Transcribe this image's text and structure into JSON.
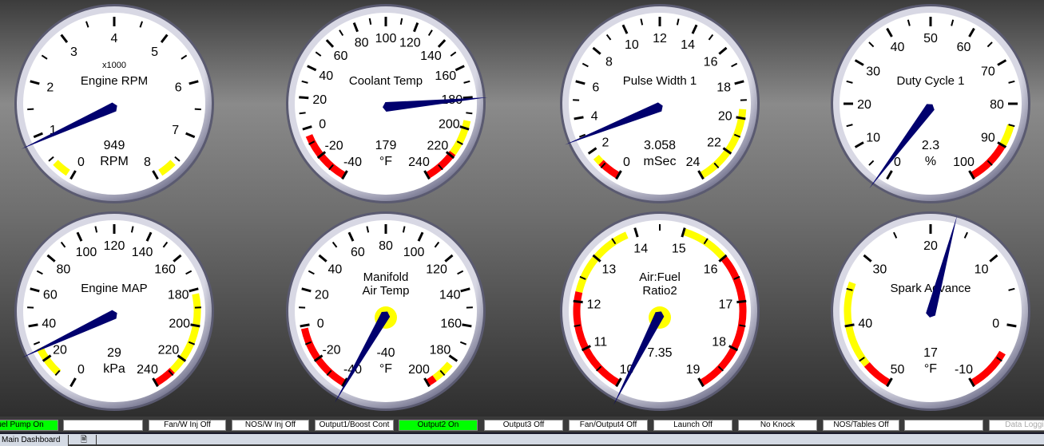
{
  "gauges": [
    {
      "title": "Engine RPM",
      "multiplier": "x1000",
      "value": "949",
      "units": "RPM",
      "needle": 0.949,
      "min": 0,
      "max": 8,
      "labels": [
        "0",
        "1",
        "2",
        "3",
        "4",
        "5",
        "6",
        "7",
        "8"
      ],
      "zones": [
        {
          "from": 0.1,
          "to": 0.4,
          "color": "#ffff00"
        },
        {
          "from": 7.6,
          "to": 7.9,
          "color": "#ffff00"
        }
      ],
      "hub": false
    },
    {
      "title": "Coolant Temp",
      "value": "179",
      "units": "°F",
      "needle": 179,
      "min": -40,
      "max": 240,
      "labels": [
        "-40",
        "-20",
        "0",
        "20",
        "40",
        "60",
        "80",
        "100",
        "120",
        "140",
        "160",
        "180",
        "200",
        "220",
        "240"
      ],
      "zones": [
        {
          "from": -40,
          "to": -5,
          "color": "#ff0000"
        },
        {
          "from": 195,
          "to": 220,
          "color": "#ffff00"
        },
        {
          "from": 218,
          "to": 240,
          "color": "#ff0000"
        }
      ],
      "hub": false
    },
    {
      "title": "Pulse Width 1",
      "value": "3.058",
      "units": "mSec",
      "needle": 3.058,
      "min": 0,
      "max": 24,
      "labels": [
        "0",
        "2",
        "4",
        "6",
        "8",
        "10",
        "12",
        "14",
        "16",
        "18",
        "20",
        "22",
        "24"
      ],
      "zones": [
        {
          "from": 0,
          "to": 1.2,
          "color": "#ff0000"
        },
        {
          "from": 1.2,
          "to": 1.6,
          "color": "#ffff00"
        },
        {
          "from": 19.5,
          "to": 24,
          "color": "#ffff00"
        },
        {
          "from": 24,
          "to": 25,
          "color": "#ff0000"
        }
      ],
      "hub": false
    },
    {
      "title": "Duty Cycle 1",
      "value": "2.3",
      "units": "%",
      "needle": 2.3,
      "min": 0,
      "max": 100,
      "labels": [
        "0",
        "10",
        "20",
        "30",
        "40",
        "50",
        "60",
        "70",
        "80",
        "90",
        "100"
      ],
      "zones": [
        {
          "from": 85,
          "to": 90,
          "color": "#ffff00"
        },
        {
          "from": 90,
          "to": 100,
          "color": "#ff0000"
        }
      ],
      "hub": false
    },
    {
      "title": "Engine MAP",
      "value": "29",
      "units": "kPa",
      "needle": 29,
      "min": 0,
      "max": 250,
      "labels": [
        "0",
        "20",
        "40",
        "60",
        "80",
        "100",
        "120",
        "140",
        "160",
        "180",
        "200",
        "220",
        "240"
      ],
      "zones": [
        {
          "from": 10,
          "to": 28,
          "color": "#ffff00"
        },
        {
          "from": 190,
          "to": 238,
          "color": "#ffff00"
        },
        {
          "from": 238,
          "to": 250,
          "color": "#ff0000"
        }
      ],
      "hub": false
    },
    {
      "title": "Manifold\nAir Temp",
      "value": "-40",
      "units": "°F",
      "needle": -40,
      "min": -40,
      "max": 210,
      "labels": [
        "-40",
        "-20",
        "0",
        "20",
        "40",
        "60",
        "80",
        "100",
        "120",
        "140",
        "160",
        "180",
        "200"
      ],
      "zones": [
        {
          "from": -40,
          "to": 0,
          "color": "#ff0000"
        },
        {
          "from": 193,
          "to": 205,
          "color": "#ffff00"
        },
        {
          "from": 205,
          "to": 210,
          "color": "#ff0000"
        }
      ],
      "hub": true
    },
    {
      "title": "Air:Fuel\nRatio2",
      "value": "7.35",
      "units": "",
      "needle": 7.35,
      "min": 10,
      "max": 19,
      "labels": [
        "10",
        "11",
        "12",
        "13",
        "14",
        "15",
        "16",
        "17",
        "18",
        "19"
      ],
      "zones": [
        {
          "from": 10,
          "to": 12.2,
          "color": "#ff0000"
        },
        {
          "from": 12.2,
          "to": 13.8,
          "color": "#ffff00"
        },
        {
          "from": 15,
          "to": 16,
          "color": "#ffff00"
        },
        {
          "from": 16,
          "to": 19,
          "color": "#ff0000"
        }
      ],
      "hub": true
    },
    {
      "title": "Spark Advance",
      "value": "17",
      "units": "°F",
      "needle": 17,
      "min": 50,
      "max": -10,
      "labels": [
        "50",
        "40",
        "30",
        "20",
        "10",
        "0",
        "-10"
      ],
      "zones": [
        {
          "from": 46,
          "to": 34,
          "color": "#ffff00"
        },
        {
          "from": 50,
          "to": 46,
          "color": "#ff0000"
        },
        {
          "from": -4,
          "to": -10,
          "color": "#ff0000"
        }
      ],
      "hub": false
    }
  ],
  "indicators": [
    {
      "label": "Fuel Pump On",
      "state": "on"
    },
    {
      "label": "",
      "state": "off"
    },
    {
      "label": "Fan/W Inj Off",
      "state": "off"
    },
    {
      "label": "NOS/W Inj Off",
      "state": "off"
    },
    {
      "label": "Output1/Boost Cont",
      "state": "off"
    },
    {
      "label": "Output2 On",
      "state": "on"
    },
    {
      "label": "Output3 Off",
      "state": "off"
    },
    {
      "label": "Fan/Output4 Off",
      "state": "off"
    },
    {
      "label": "Launch Off",
      "state": "off"
    },
    {
      "label": "No Knock",
      "state": "off"
    },
    {
      "label": "NOS/Tables Off",
      "state": "off"
    },
    {
      "label": "",
      "state": "off"
    },
    {
      "label": "Data Logging",
      "state": "dim"
    }
  ],
  "tabs": [
    {
      "label": "Main Dashboard"
    },
    {
      "label": ""
    }
  ],
  "colors": {
    "needle": "#00006e",
    "hub": "#ffff00",
    "on": "#00ff00"
  }
}
